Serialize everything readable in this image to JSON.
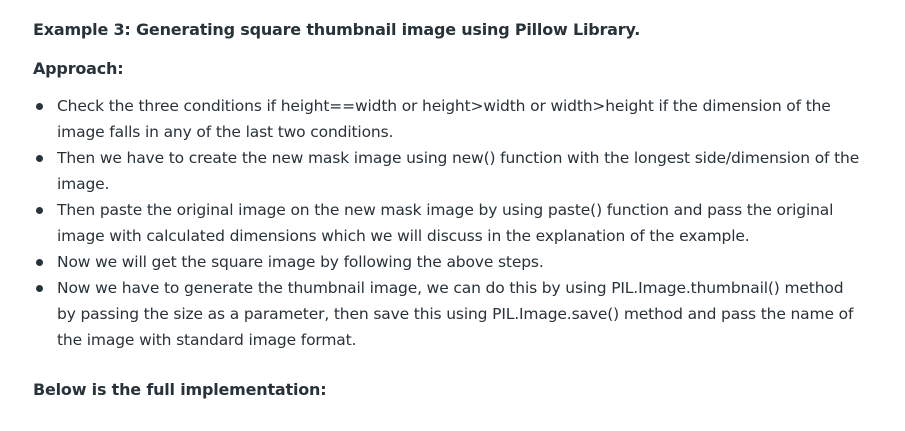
{
  "article": {
    "example_heading": "Example 3: Generating square thumbnail image using Pillow Library.",
    "approach_heading": "Approach:",
    "steps": [
      {
        "lines": [
          "Check the three conditions if height==width or height>width or width>height if the dimension of the",
          "image falls in any of the last two conditions."
        ]
      },
      {
        "lines": [
          "Then we have to create the new mask image using new() function with the longest side/dimension of the",
          "image."
        ]
      },
      {
        "lines": [
          "Then paste the original image on the new mask image by using paste() function and pass the original",
          "image with calculated dimensions which we will discuss in the explanation of the example."
        ]
      },
      {
        "lines": [
          "Now we will get the square image by following the above steps."
        ]
      },
      {
        "lines": [
          "Now we have to generate the thumbnail image, we can do this by using PIL.Image.thumbnail() method",
          "by passing the size as a parameter, then save this using PIL.Image.save() method and pass the name of",
          "the image with standard image format."
        ]
      }
    ],
    "below_heading": "Below is the full implementation:"
  }
}
